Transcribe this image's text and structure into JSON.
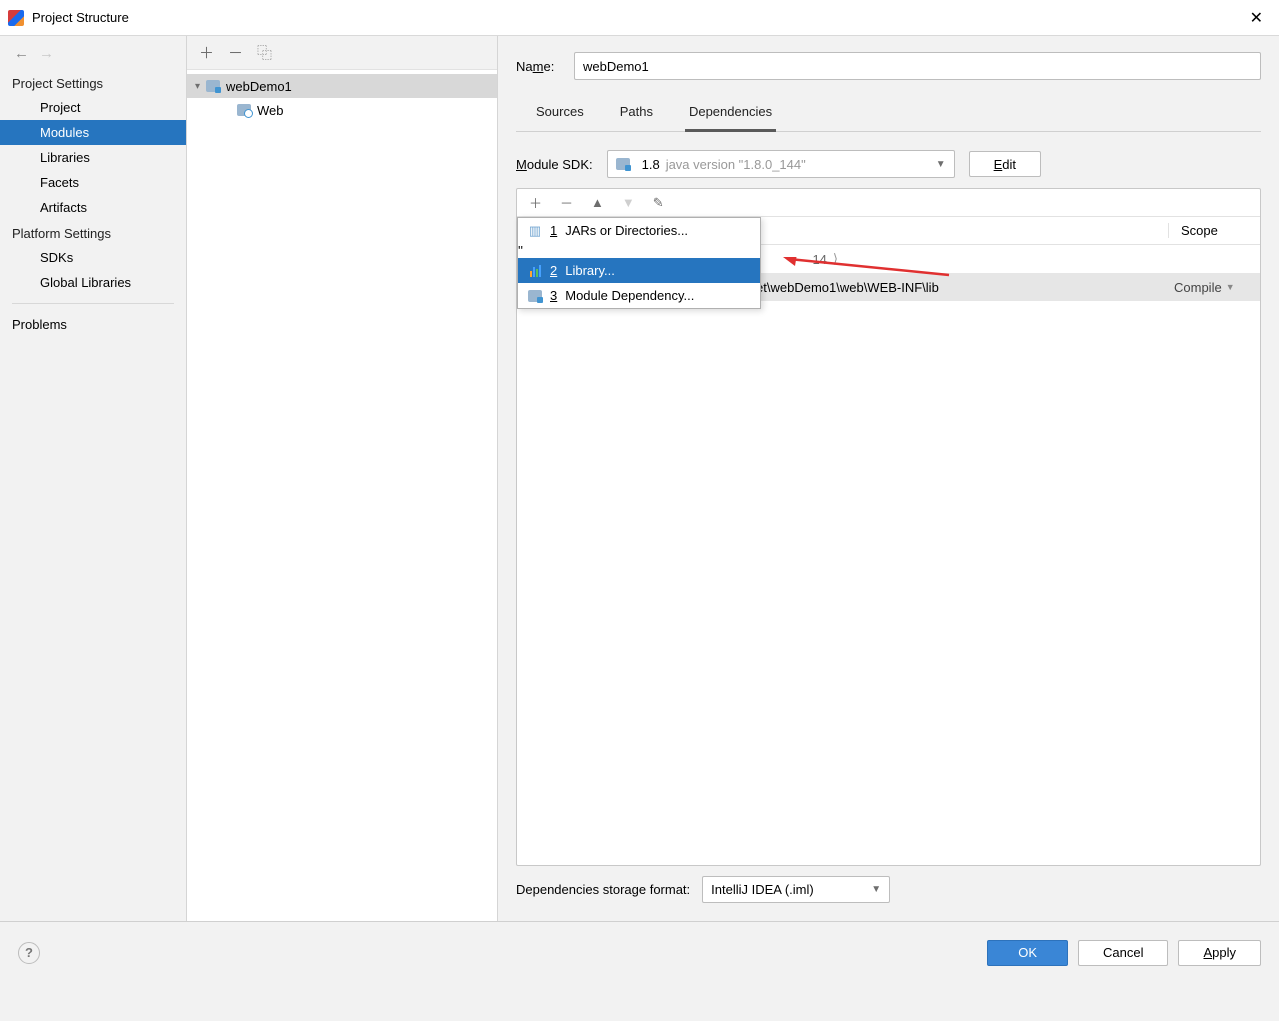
{
  "window": {
    "title": "Project Structure"
  },
  "sidebar": {
    "sectionA": "Project Settings",
    "itemsA": [
      "Project",
      "Modules",
      "Libraries",
      "Facets",
      "Artifacts"
    ],
    "sectionB": "Platform Settings",
    "itemsB": [
      "SDKs",
      "Global Libraries"
    ],
    "problems": "Problems"
  },
  "tree": {
    "root": "webDemo1",
    "child": "Web"
  },
  "detail": {
    "nameLabel": "Name:",
    "nameValue": "webDemo1",
    "tabs": [
      "Sources",
      "Paths",
      "Dependencies"
    ],
    "sdkLabel": "Module SDK:",
    "sdkName": "1.8",
    "sdkVersion": "java version \"1.8.0_144\"",
    "editBtn": "Edit",
    "scopeHeader": "Scope",
    "storageLabel": "Dependencies storage format:",
    "storageValue": "IntelliJ IDEA (.iml)"
  },
  "addPopup": {
    "items": [
      {
        "num": "1",
        "label": "JARs or Directories..."
      },
      {
        "num": "2",
        "label": "Library..."
      },
      {
        "num": "3",
        "label": "Module Dependency..."
      }
    ],
    "selectedIndex": 1
  },
  "dependencies": {
    "rowObscured": "14",
    "row2Path": "D:\\ruanjian\\idea\\work\\webservlet\\webDemo1\\web\\WEB-INF\\lib",
    "row2Scope": "Compile"
  },
  "footer": {
    "ok": "OK",
    "cancel": "Cancel",
    "apply": "Apply"
  }
}
